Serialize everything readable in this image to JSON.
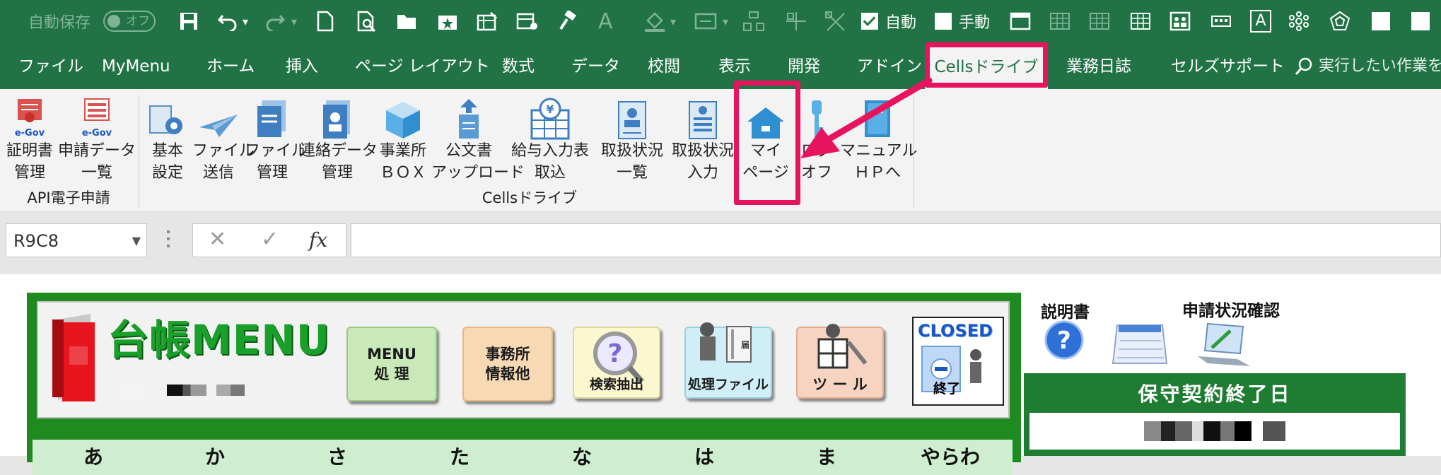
{
  "qat": {
    "autosave_label": "自動保存",
    "autosave_state": "オフ",
    "auto_label": "自動",
    "manual_label": "手動"
  },
  "tabs": [
    "ファイル",
    "MyMenu",
    "ホーム",
    "挿入",
    "ページ レイアウト",
    "数式",
    "データ",
    "校閲",
    "表示",
    "開発",
    "アドイン",
    "Cellsドライブ",
    "業務日誌",
    "セルズサポート"
  ],
  "tell_me": "実行したい作業を",
  "ribbon": {
    "buttons": [
      {
        "line1": "証明書",
        "line2": "管理"
      },
      {
        "line1": "申請データ",
        "line2": "一覧"
      },
      {
        "line1": "基本",
        "line2": "設定"
      },
      {
        "line1": "ファイル",
        "line2": "送信"
      },
      {
        "line1": "ファイル",
        "line2": "管理"
      },
      {
        "line1": "連絡データ",
        "line2": "管理"
      },
      {
        "line1": "事業所",
        "line2": "ＢＯＸ"
      },
      {
        "line1": "公文書",
        "line2": "アップロード"
      },
      {
        "line1": "給与入力表",
        "line2": "取込"
      },
      {
        "line1": "取扱状況",
        "line2": "一覧"
      },
      {
        "line1": "取扱状況",
        "line2": "入力"
      },
      {
        "line1": "マイ",
        "line2": "ページ"
      },
      {
        "line1": "ログ",
        "line2": "オフ"
      },
      {
        "line1": "マニュアル",
        "line2": "ＨＰへ"
      }
    ],
    "groups": [
      "API電子申請",
      "Cellsドライブ"
    ]
  },
  "formula_bar": {
    "name_box": "R9C8",
    "fx": "fx"
  },
  "sheet": {
    "title": "台帳MENU",
    "buttons": [
      {
        "line1": "MENU",
        "line2": "処 理"
      },
      {
        "line1": "事務所",
        "line2": "情報他"
      },
      {
        "line1": "検索抽出",
        "line2": ""
      },
      {
        "line1": "処理ファイル",
        "line2": ""
      },
      {
        "line1": "ツ ー ル",
        "line2": ""
      },
      {
        "line1": "CLOSED",
        "line2": "終了"
      }
    ],
    "kana": [
      "あ",
      "か",
      "さ",
      "た",
      "な",
      "は",
      "ま",
      "やらわ"
    ],
    "manual_label": "説明書",
    "status_label": "申請状況確認",
    "contract_end_label": "保守契約終了日"
  },
  "colors": {
    "excel_green": "#217346",
    "highlight": "#e8135f",
    "sheet_green": "#1f8a1f"
  }
}
